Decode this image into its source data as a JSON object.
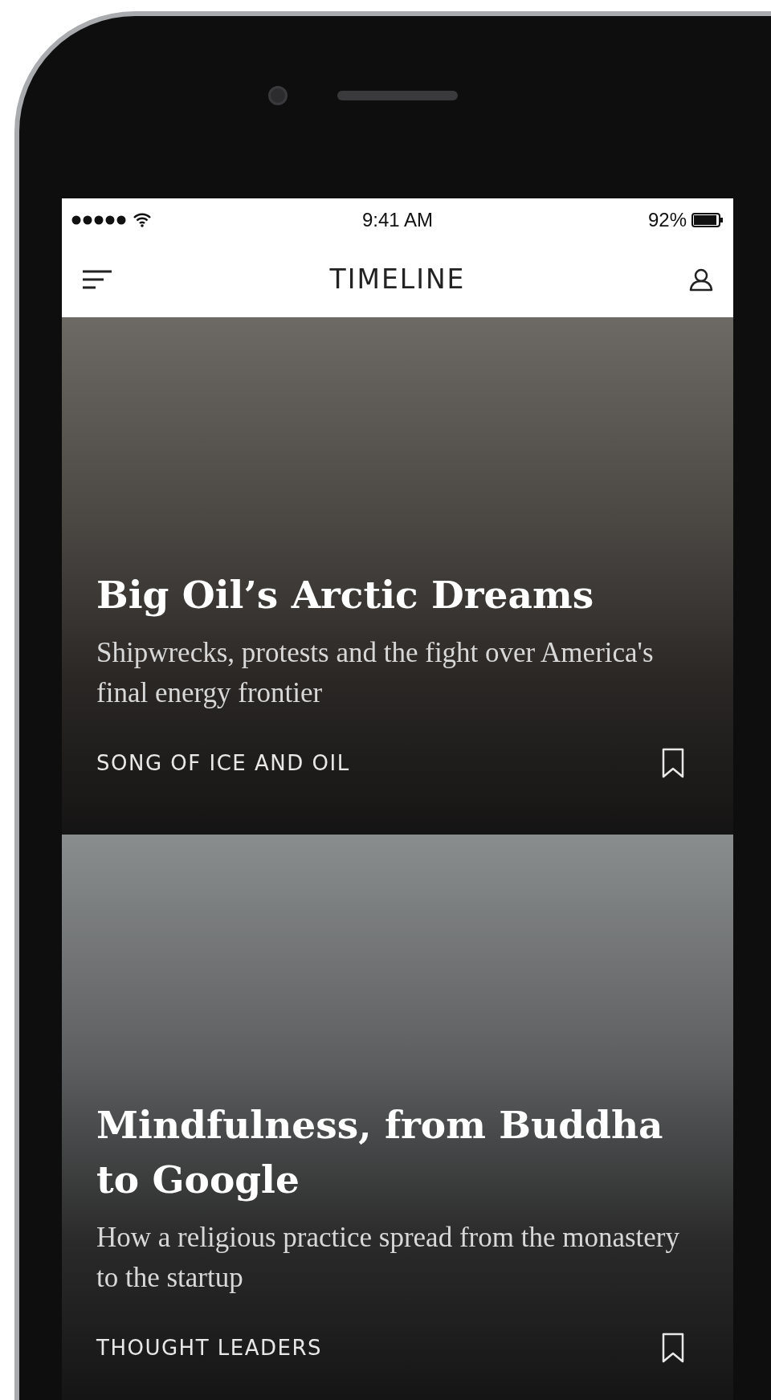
{
  "status_bar": {
    "time": "9:41 AM",
    "battery": "92%"
  },
  "nav": {
    "title": "TIMELINE"
  },
  "stories": [
    {
      "title": "Big Oil’s Arctic Dreams",
      "subtitle": "Shipwrecks, protests and the fight over America's final energy frontier",
      "category": "SONG OF ICE AND OIL"
    },
    {
      "title": "Mindfulness, from Buddha to Google",
      "subtitle": "How a religious practice spread from the monastery to the startup",
      "category": "THOUGHT LEADERS"
    }
  ]
}
